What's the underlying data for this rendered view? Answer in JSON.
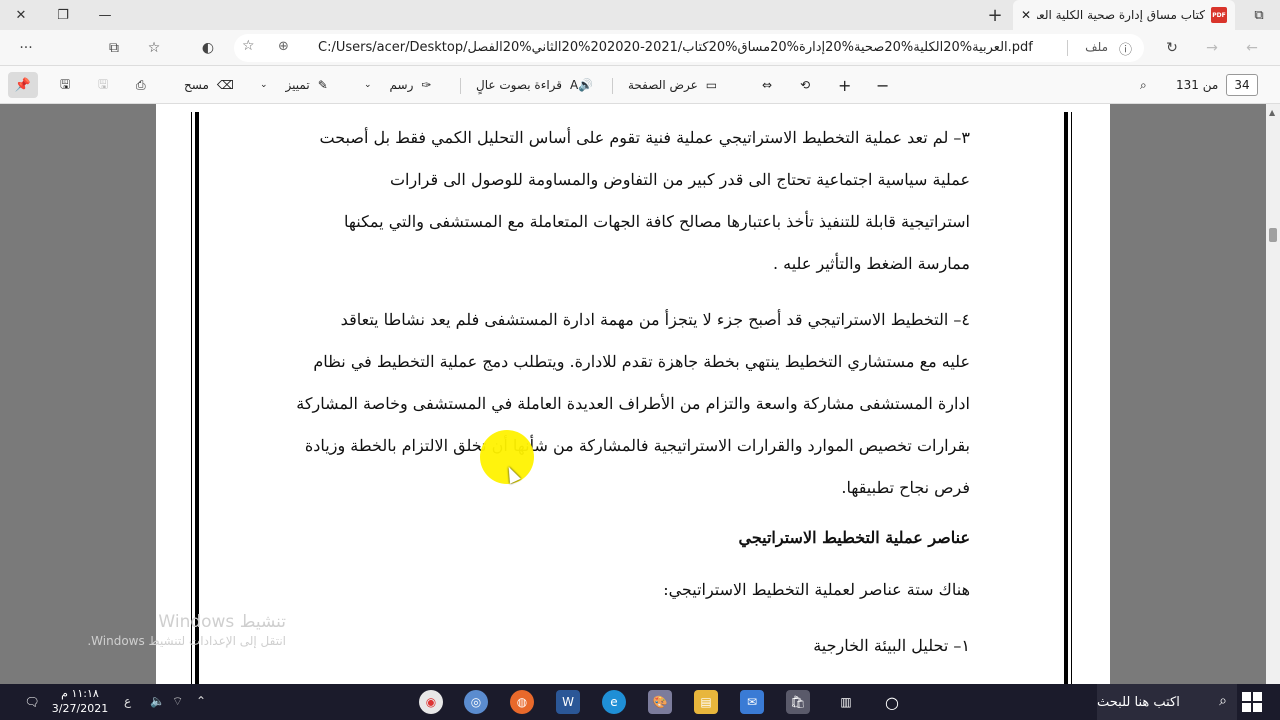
{
  "tab": {
    "title": "كتاب مساق إدارة صحية الكلية العر",
    "pdf_icon_text": "PDF"
  },
  "address": {
    "url": "C:/Users/acer/Desktop/العربية%20الكلية%20صحية%20إدارة%20مساق%20كتاب/2021-202020%20الثاني%20الفصل.pdf",
    "file_label": "ملف"
  },
  "toolbar": {
    "page_current": "34",
    "page_total": "من 131",
    "fit_page": "عرض الصفحة",
    "read_aloud": "قراءة بصوت عالٍ",
    "draw": "رسم",
    "highlight": "تمييز",
    "erase": "مسح"
  },
  "document": {
    "lines": [
      "٣– لم تعد عملية التخطيط الاستراتيجي عملية فنية تقوم على أساس التحليل الكمي فقط بل أصبحت",
      "عملية سياسية اجتماعية تحتاج الى قدر كبير من التفاوض والمساومة للوصول الى قرارات",
      "استراتيجية قابلة للتنفيذ تأخذ باعتبارها مصالح كافة الجهات المتعاملة مع المستشفى والتي يمكنها",
      "ممارسة الضغط والتأثير عليه .",
      "٤– التخطيط الاستراتيجي قد أصبح جزء لا يتجزأ من مهمة ادارة المستشفى فلم يعد نشاطا يتعاقد",
      "عليه مع مستشاري التخطيط ينتهي بخطة جاهزة تقدم للادارة. ويتطلب دمج عملية التخطيط في نظام",
      "ادارة المستشفى مشاركة واسعة والتزام من الأطراف العديدة العاملة في المستشفى وخاصة المشاركة",
      "بقرارات تخصيص الموارد والقرارات الاستراتيجية فالمشاركة من شأنها أن تخلق الالتزام بالخطة وزيادة",
      "فرص نجاح تطبيقها."
    ],
    "heading": "عناصر عملية التخطيط الاستراتيجي",
    "intro": "هناك ستة عناصر لعملية التخطيط الاستراتيجي:",
    "item1": "١– تحليل البيئة الخارجية"
  },
  "watermark": {
    "line1": "تنشيط Windows",
    "line2": "انتقل إلى الإعدادات لتنشيط Windows."
  },
  "taskbar": {
    "search": "اكتب هنا للبحث",
    "time": "١١:١٨ م",
    "date": "3/27/2021",
    "lang": "ع"
  }
}
